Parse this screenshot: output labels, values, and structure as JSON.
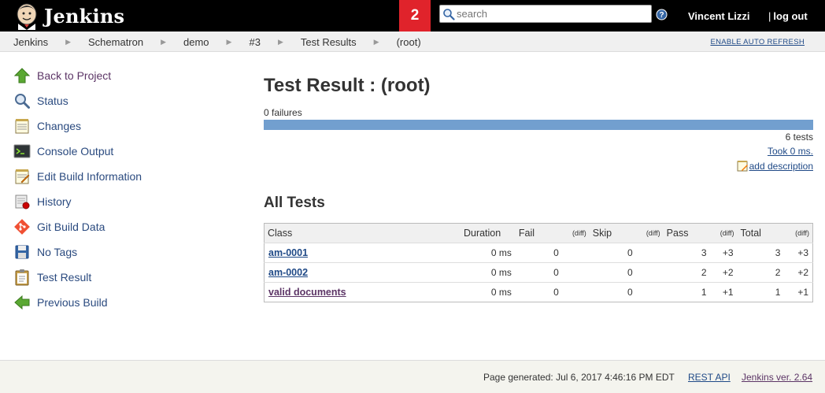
{
  "header": {
    "brand": "Jenkins",
    "notification_count": "2",
    "search_placeholder": "search",
    "user_name": "Vincent Lizzi",
    "logout_label": "log out",
    "logout_separator": "|"
  },
  "breadcrumbs": [
    "Jenkins",
    "Schematron",
    "demo",
    "#3",
    "Test Results",
    "(root)"
  ],
  "auto_refresh_label": "ENABLE AUTO REFRESH",
  "sidebar": {
    "items": [
      {
        "label": "Back to Project",
        "icon": "up-arrow-icon"
      },
      {
        "label": "Status",
        "icon": "magnifier-icon"
      },
      {
        "label": "Changes",
        "icon": "notepad-icon"
      },
      {
        "label": "Console Output",
        "icon": "terminal-icon"
      },
      {
        "label": "Edit Build Information",
        "icon": "notepad-pencil-icon"
      },
      {
        "label": "History",
        "icon": "history-icon"
      },
      {
        "label": "Git Build Data",
        "icon": "git-icon"
      },
      {
        "label": "No Tags",
        "icon": "floppy-icon"
      },
      {
        "label": "Test Result",
        "icon": "clipboard-icon"
      },
      {
        "label": "Previous Build",
        "icon": "left-arrow-icon"
      }
    ]
  },
  "main": {
    "title": "Test Result : (root)",
    "failures": "0 failures",
    "progress": {
      "pass_fraction": 1.0,
      "color": "#729fcf"
    },
    "tests_count": "6 tests",
    "took": "Took 0 ms.",
    "add_description": "add description",
    "all_tests_heading": "All Tests",
    "table": {
      "headers": {
        "class": "Class",
        "duration": "Duration",
        "fail": "Fail",
        "diff": "(diff)",
        "skip": "Skip",
        "pass": "Pass",
        "total": "Total"
      },
      "rows": [
        {
          "class": "am-0001",
          "duration": "0 ms",
          "fail": "0",
          "fail_diff": "",
          "skip": "0",
          "skip_diff": "",
          "pass": "3",
          "pass_diff": "+3",
          "total": "3",
          "total_diff": "+3"
        },
        {
          "class": "am-0002",
          "duration": "0 ms",
          "fail": "0",
          "fail_diff": "",
          "skip": "0",
          "skip_diff": "",
          "pass": "2",
          "pass_diff": "+2",
          "total": "2",
          "total_diff": "+2"
        },
        {
          "class": "valid documents",
          "duration": "0 ms",
          "fail": "0",
          "fail_diff": "",
          "skip": "0",
          "skip_diff": "",
          "pass": "1",
          "pass_diff": "+1",
          "total": "1",
          "total_diff": "+1"
        }
      ]
    }
  },
  "footer": {
    "generated": "Page generated: Jul 6, 2017 4:46:16 PM EDT",
    "rest_api": "REST API",
    "version": "Jenkins ver. 2.64"
  },
  "colors": {
    "header_bg": "#000000",
    "notification_bg": "#e0232b",
    "link": "#204a87",
    "visited": "#5c3566"
  }
}
